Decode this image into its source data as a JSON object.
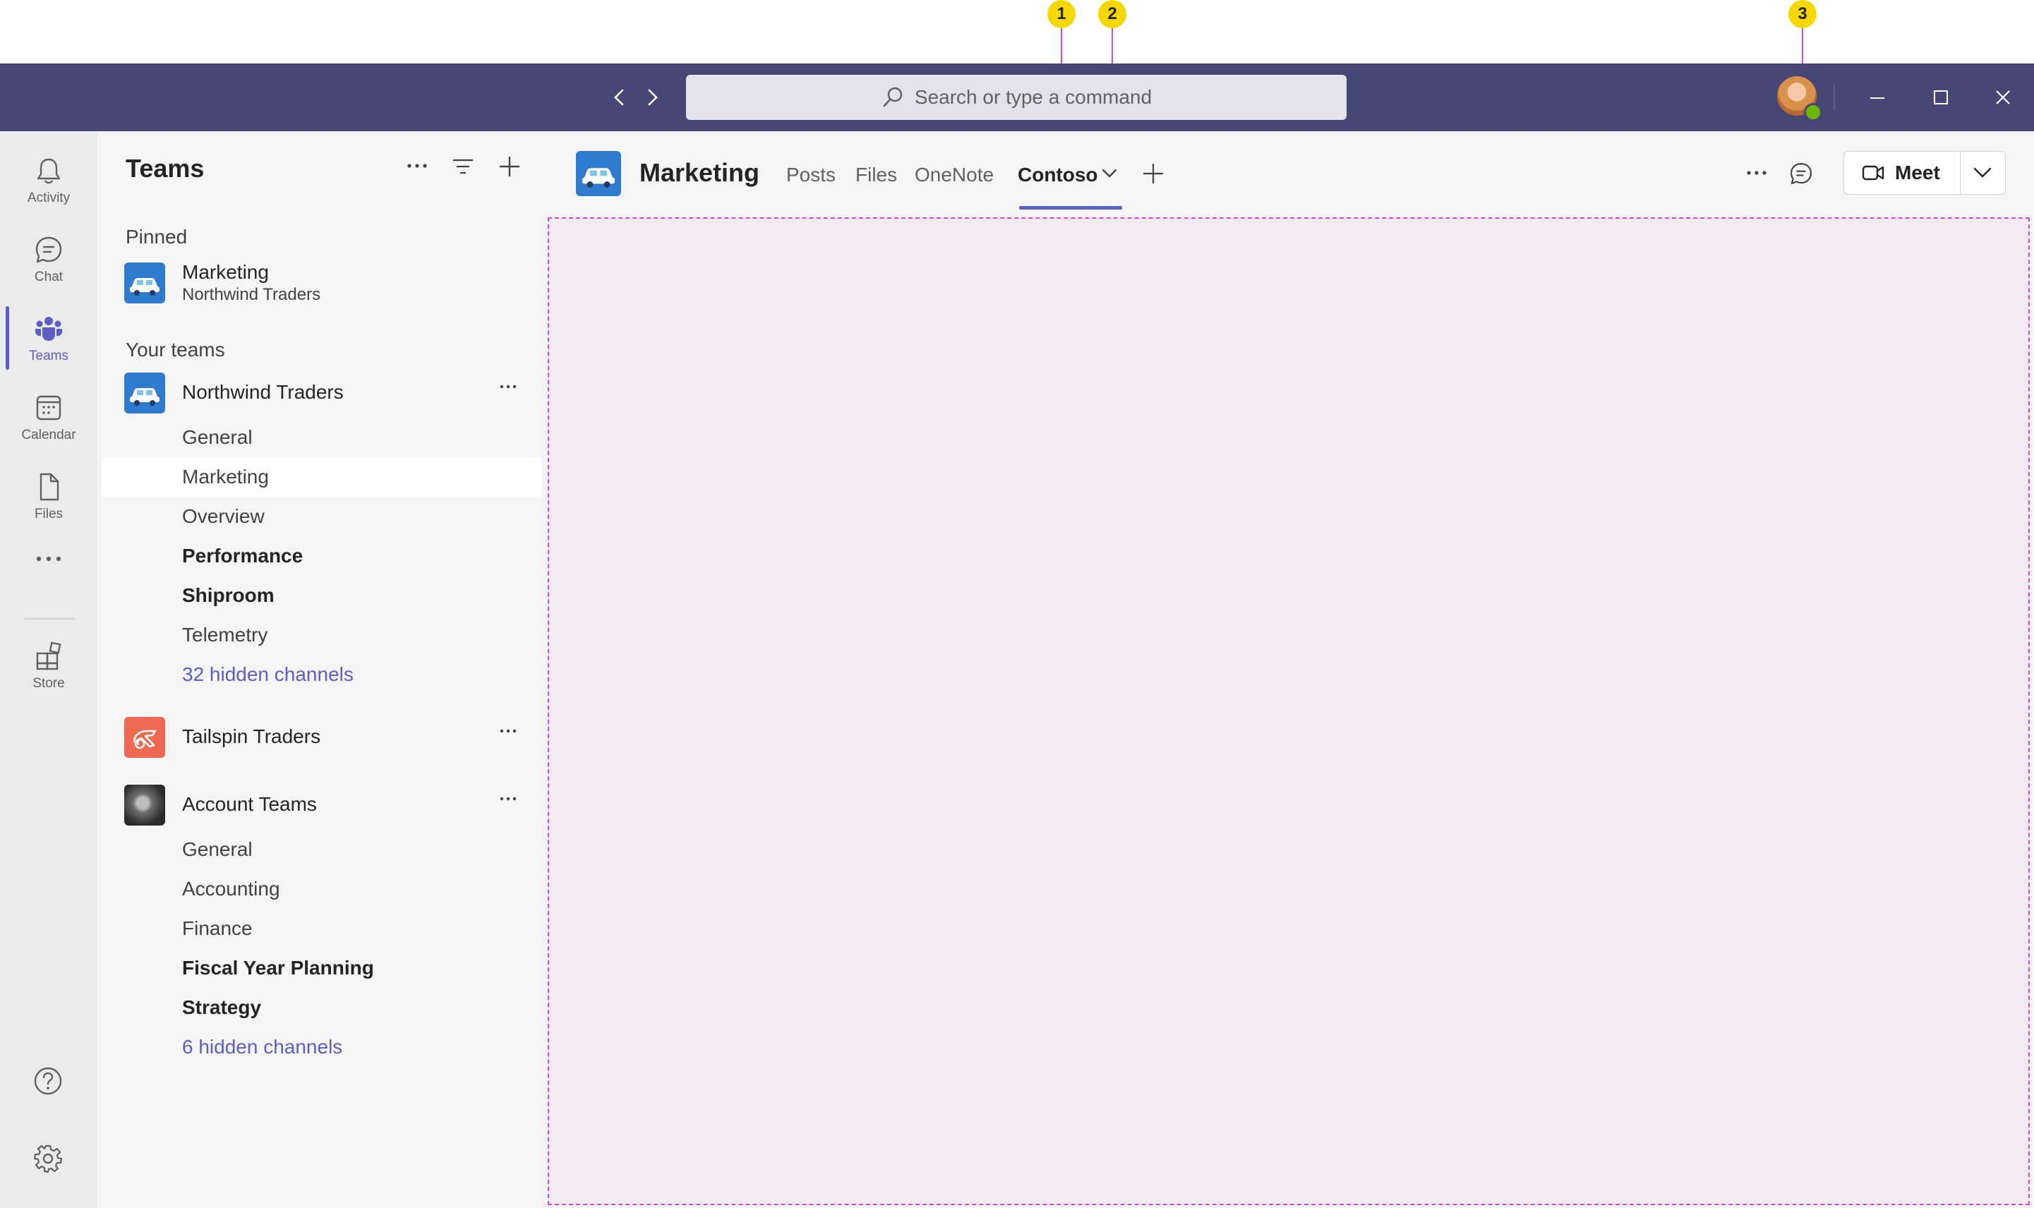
{
  "callouts": [
    "1",
    "2",
    "3"
  ],
  "search": {
    "placeholder": "Search or type a command"
  },
  "rail": {
    "items": [
      {
        "label": "Activity",
        "icon": "bell-icon"
      },
      {
        "label": "Chat",
        "icon": "chat-icon"
      },
      {
        "label": "Teams",
        "icon": "teams-icon",
        "active": true
      },
      {
        "label": "Calendar",
        "icon": "calendar-icon"
      },
      {
        "label": "Files",
        "icon": "file-icon"
      },
      {
        "label": "Store",
        "icon": "store-icon"
      }
    ]
  },
  "panel": {
    "title": "Teams",
    "pinned_label": "Pinned",
    "pinned": {
      "name": "Marketing",
      "subtitle": "Northwind Traders"
    },
    "your_teams_label": "Your teams",
    "teams": [
      {
        "name": "Northwind Traders",
        "channels": [
          "General",
          "Marketing",
          "Overview",
          "Performance",
          "Shiproom",
          "Telemetry"
        ],
        "hidden": "32 hidden channels"
      },
      {
        "name": "Tailspin Traders"
      },
      {
        "name": "Account Teams",
        "channels": [
          "General",
          "Accounting",
          "Finance",
          "Fiscal Year Planning",
          "Strategy"
        ],
        "hidden": "6 hidden channels"
      }
    ]
  },
  "header": {
    "channel_name": "Marketing",
    "tabs": [
      "Posts",
      "Files",
      "OneNote",
      "Contoso"
    ],
    "active_tab": "Contoso",
    "meet_label": "Meet"
  },
  "colors": {
    "titlebar": "#464775",
    "accent": "#5b5fc7",
    "callout": "#f5d800",
    "callout_line": "#d04bcd",
    "content_bg": "#f4eaf3"
  }
}
